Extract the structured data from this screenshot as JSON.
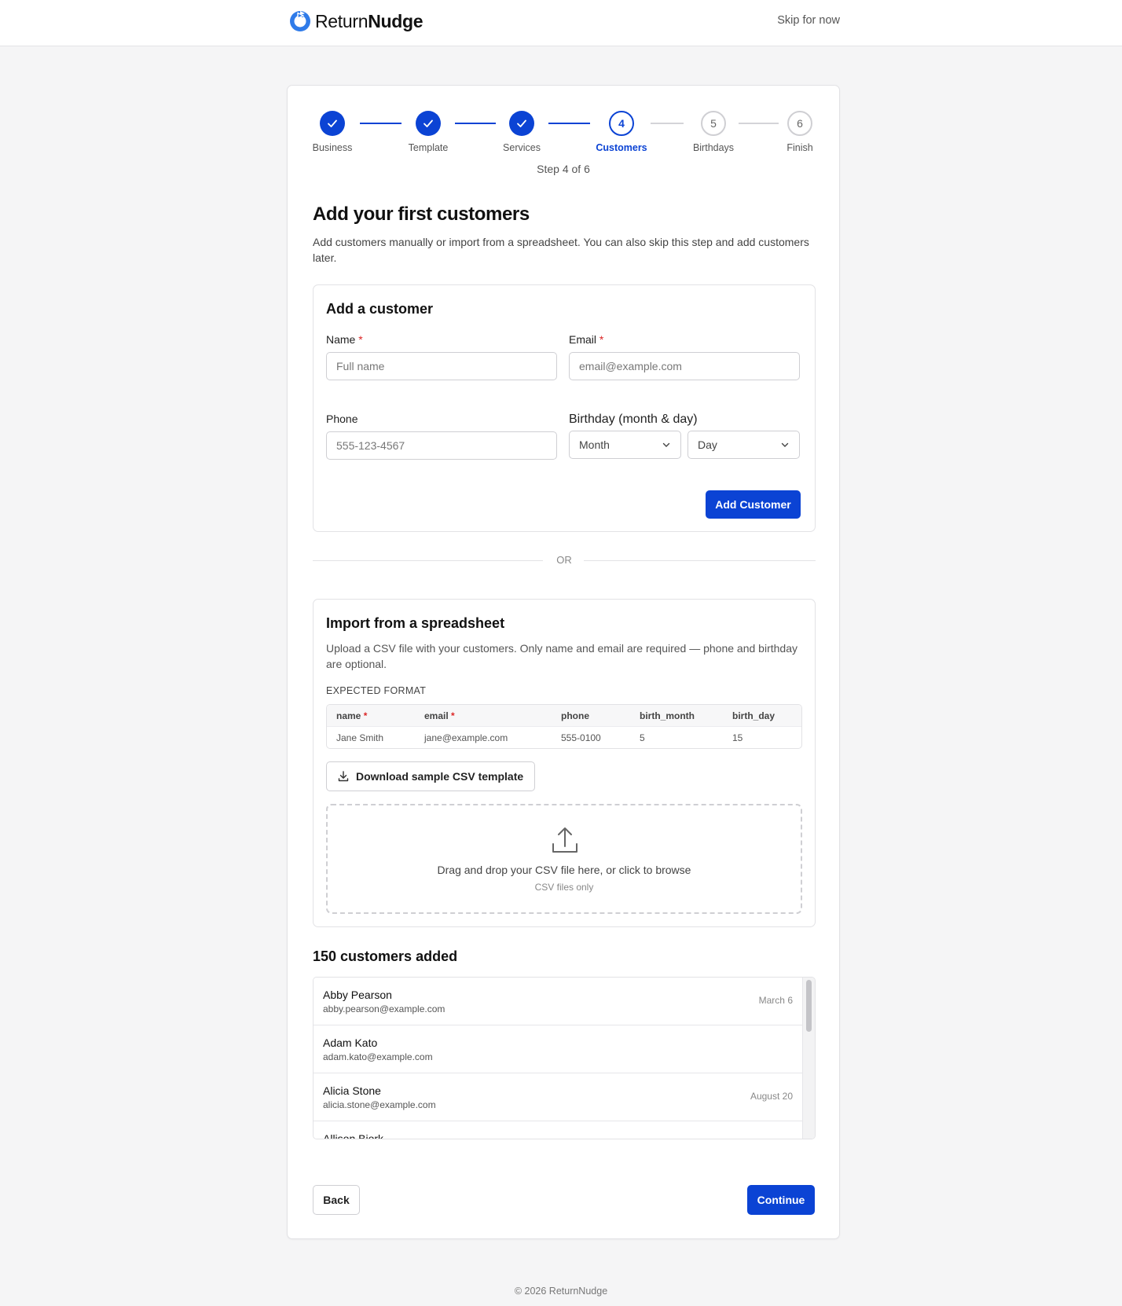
{
  "brand": {
    "name_regular": "Return",
    "name_bold": "Nudge"
  },
  "header": {
    "skip_label": "Skip for now"
  },
  "stepper": {
    "steps": [
      {
        "number": "1",
        "label": "Business",
        "state": "done"
      },
      {
        "number": "2",
        "label": "Template",
        "state": "done"
      },
      {
        "number": "3",
        "label": "Services",
        "state": "done"
      },
      {
        "number": "4",
        "label": "Customers",
        "state": "active"
      },
      {
        "number": "5",
        "label": "Birthdays",
        "state": "todo"
      },
      {
        "number": "6",
        "label": "Finish",
        "state": "todo"
      }
    ],
    "progress_text": "Step 4 of 6"
  },
  "page": {
    "title": "Add your first customers",
    "subtitle": "Add customers manually or import from a spreadsheet. You can also skip this step and add customers later."
  },
  "add_form": {
    "title": "Add a customer",
    "name_label": "Name",
    "name_placeholder": "Full name",
    "email_label": "Email",
    "email_placeholder": "email@example.com",
    "phone_label": "Phone",
    "phone_placeholder": "555-123-4567",
    "birthday_label": "Birthday (month & day)",
    "month_value": "Month",
    "day_value": "Day",
    "required_mark": "*",
    "submit_label": "Add Customer"
  },
  "divider": {
    "text": "OR"
  },
  "import": {
    "title": "Import from a spreadsheet",
    "description": "Upload a CSV file with your customers. Only name and email are required — phone and birthday are optional.",
    "format_label": "EXPECTED FORMAT",
    "columns": [
      "name",
      "email",
      "phone",
      "birth_month",
      "birth_day"
    ],
    "sample_row": [
      "Jane Smith",
      "jane@example.com",
      "555-0100",
      "5",
      "15"
    ],
    "download_label": "Download sample CSV template",
    "dropzone_text": "Drag and drop your CSV file here, or click to browse",
    "dropzone_subtext": "CSV files only"
  },
  "customers": {
    "count_title": "150 customers added",
    "items": [
      {
        "name": "Abby Pearson",
        "email": "abby.pearson@example.com",
        "birthday": "March 6"
      },
      {
        "name": "Adam Kato",
        "email": "adam.kato@example.com",
        "birthday": ""
      },
      {
        "name": "Alicia Stone",
        "email": "alicia.stone@example.com",
        "birthday": "August 20"
      },
      {
        "name": "Allison Bjork",
        "email": "",
        "birthday": ""
      }
    ]
  },
  "footer_nav": {
    "back_label": "Back",
    "continue_label": "Continue"
  },
  "footer": {
    "copyright": "© 2026 ReturnNudge"
  },
  "colors": {
    "accent": "#0b43d4",
    "required": "#dc2626"
  }
}
